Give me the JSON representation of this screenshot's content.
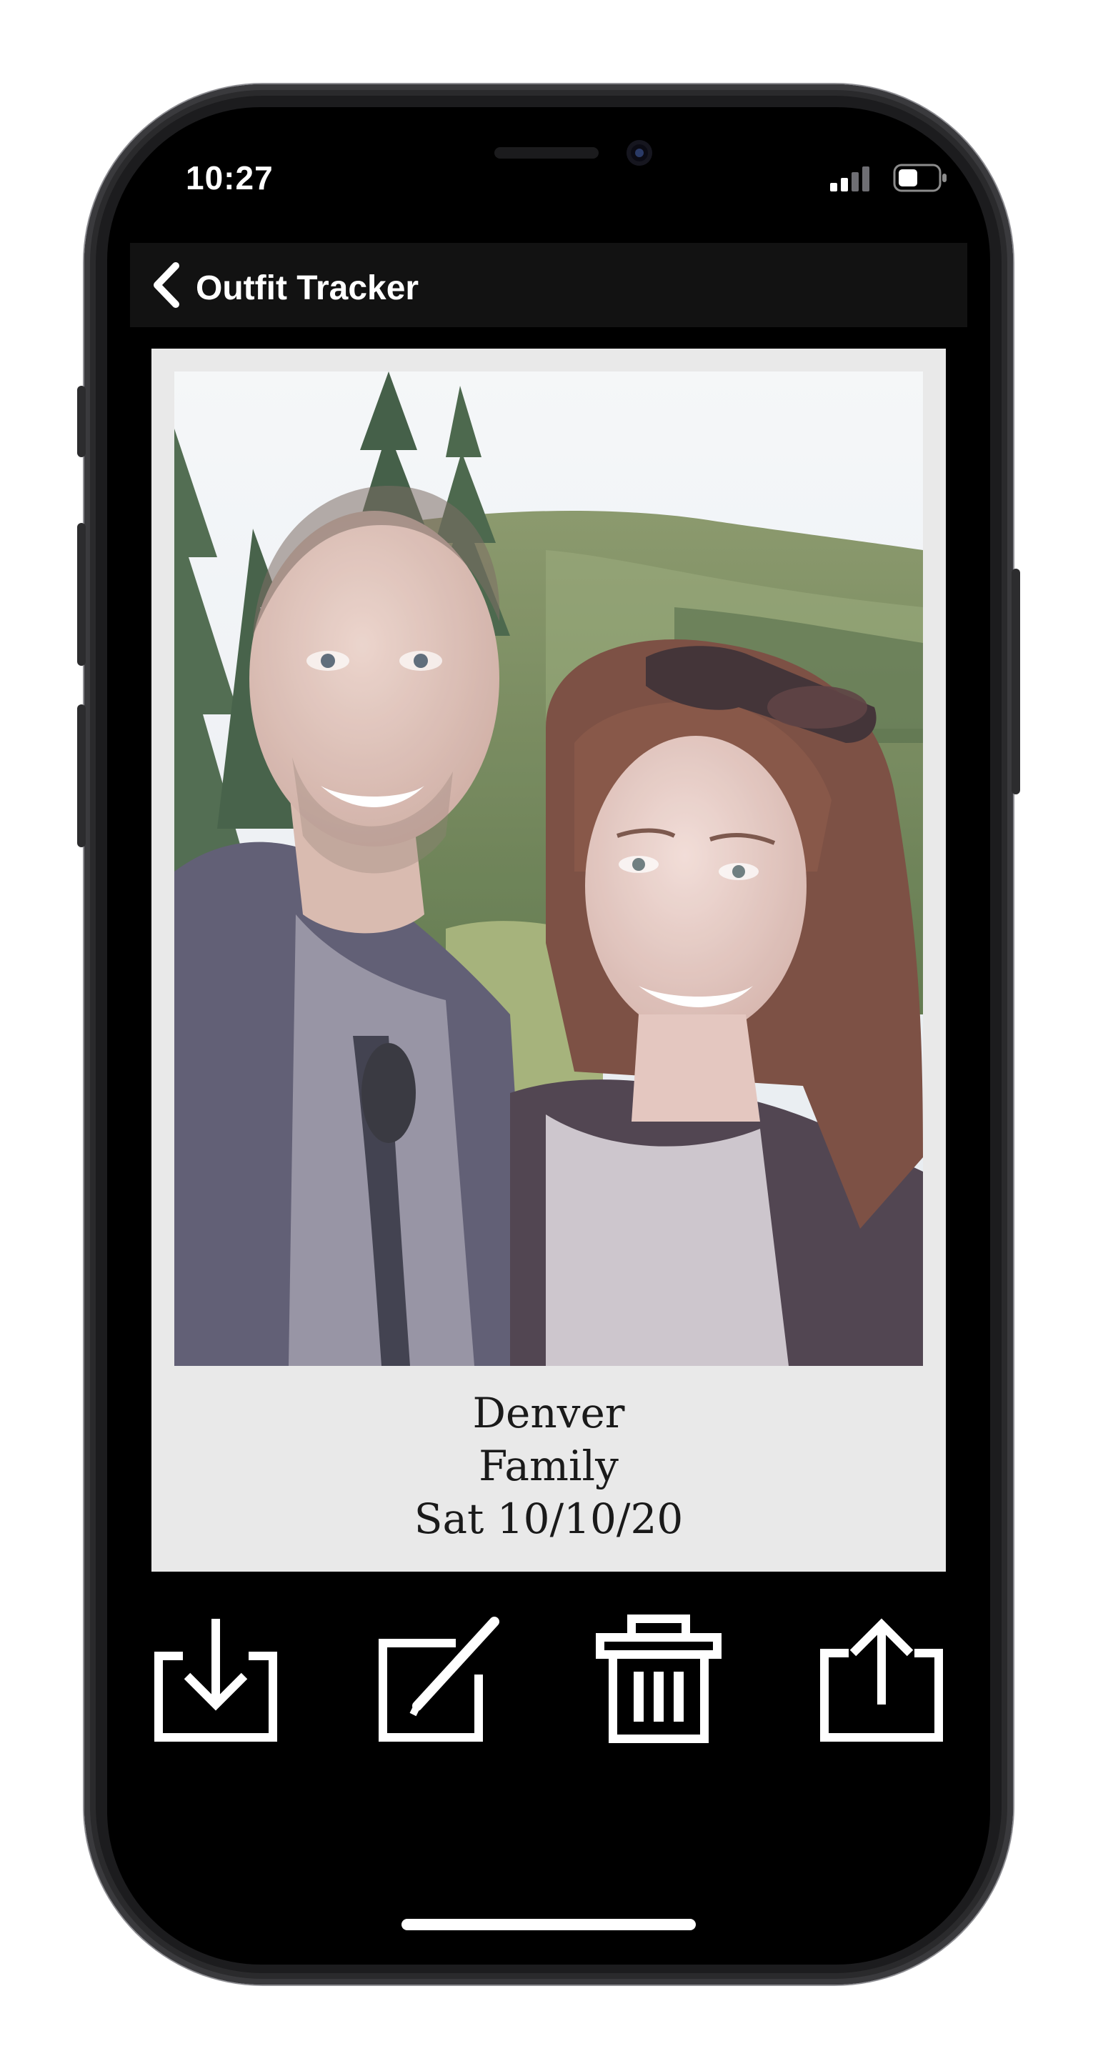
{
  "status_bar": {
    "time": "10:27"
  },
  "navbar": {
    "back_label": "Outfit Tracker"
  },
  "outfit": {
    "location": "Denver",
    "occasion": "Family",
    "date": "Sat 10/10/20"
  },
  "actions": [
    {
      "icon": "download-icon"
    },
    {
      "icon": "edit-icon"
    },
    {
      "icon": "trash-icon"
    },
    {
      "icon": "share-icon"
    }
  ],
  "colors": {
    "screen_bg": "#000000",
    "navbar_bg": "#121212",
    "card_bg": "#e9e9e9",
    "icon_color": "#ffffff"
  }
}
